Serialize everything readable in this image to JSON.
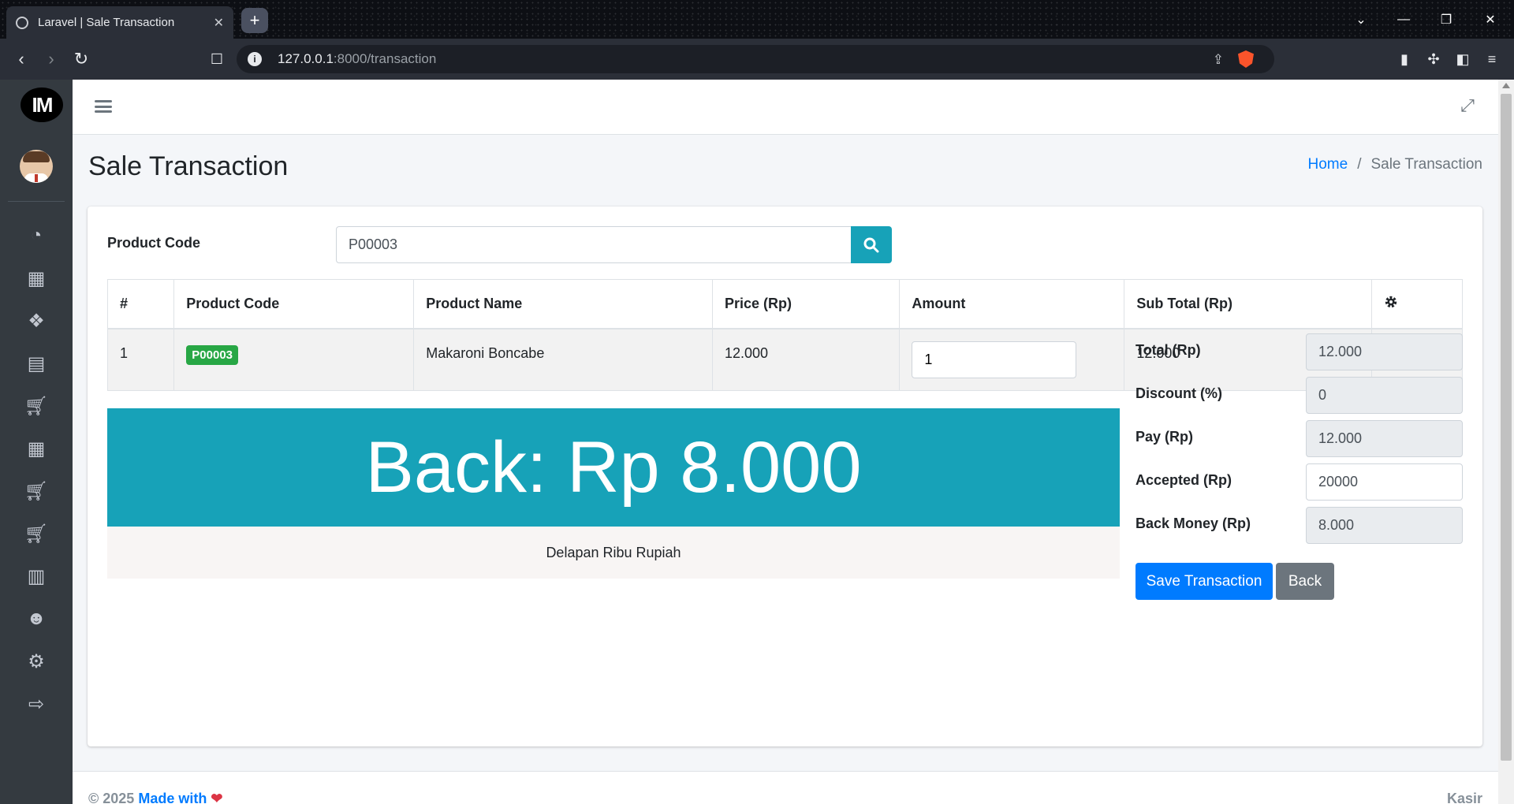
{
  "browser": {
    "tab_title": "Laravel | Sale Transaction",
    "tab_close": "✕",
    "new_tab": "+",
    "url_host": "127.0.0.1",
    "url_path": ":8000/transaction"
  },
  "sidebar": {
    "logo_text": "IM",
    "icons": [
      "dashboard-icon",
      "grid-icon",
      "cubes-icon",
      "box-icon",
      "cart-icon",
      "grid-icon",
      "cart-plus-icon",
      "cart-arrow-icon",
      "book-icon",
      "users-icon",
      "gear-icon",
      "logout-icon"
    ]
  },
  "header": {
    "page_title": "Sale Transaction",
    "breadcrumb": {
      "home": "Home",
      "separator": "/",
      "current": "Sale Transaction"
    }
  },
  "form": {
    "product_code_label": "Product Code",
    "product_code_value": "P00003"
  },
  "table": {
    "headers": [
      "#",
      "Product Code",
      "Product Name",
      "Price (Rp)",
      "Amount",
      "Sub Total (Rp)"
    ],
    "rows": [
      {
        "no": "1",
        "code": "P00003",
        "name": "Makaroni Boncabe",
        "price": "12.000",
        "amount": "1",
        "subtotal": "12.000"
      }
    ]
  },
  "back_display": {
    "text": "Back: Rp 8.000",
    "words": "Delapan Ribu Rupiah",
    "color": "#17a2b8"
  },
  "summary": {
    "total_label": "Total (Rp)",
    "total_value": "12.000",
    "discount_label": "Discount (%)",
    "discount_value": "0",
    "pay_label": "Pay (Rp)",
    "pay_value": "12.000",
    "accepted_label": "Accepted (Rp)",
    "accepted_value": "20000",
    "back_label": "Back Money (Rp)",
    "back_value": "8.000"
  },
  "buttons": {
    "save": "Save Transaction",
    "back": "Back"
  },
  "footer": {
    "copyright": "© 2025",
    "made_with": "Made with",
    "heart": "❤",
    "role": "Kasir"
  }
}
